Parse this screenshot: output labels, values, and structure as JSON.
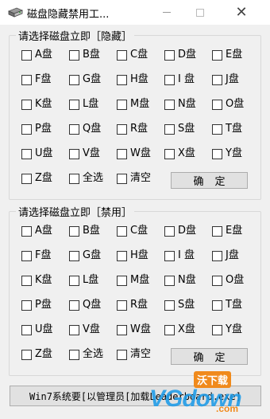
{
  "window": {
    "title": "磁盘隐藏禁用工...",
    "minimize_glyph": "—",
    "maximize_glyph": "☐",
    "close_glyph": "✕"
  },
  "groups": [
    {
      "title": "请选择磁盘立即［隐藏］",
      "drives": [
        "A盘",
        "B盘",
        "C盘",
        "D盘",
        "E盘",
        "F盘",
        "G盘",
        "H盘",
        "I 盘",
        "J盘",
        "K盘",
        "L盘",
        "M盘",
        "N盘",
        "O盘",
        "P盘",
        "Q盘",
        "R盘",
        "S盘",
        "T盘",
        "U盘",
        "V盘",
        "W盘",
        "X盘",
        "Y盘",
        "Z盘",
        "全选",
        "清空"
      ],
      "ok_label": "确定"
    },
    {
      "title": "请选择磁盘立即［禁用］",
      "drives": [
        "A盘",
        "B盘",
        "C盘",
        "D盘",
        "E盘",
        "F盘",
        "G盘",
        "H盘",
        "I 盘",
        "J盘",
        "K盘",
        "L盘",
        "M盘",
        "N盘",
        "O盘",
        "P盘",
        "Q盘",
        "R盘",
        "S盘",
        "T盘",
        "U盘",
        "V盘",
        "W盘",
        "X盘",
        "Y盘",
        "Z盘",
        "全选",
        "清空"
      ],
      "ok_label": "确定"
    }
  ],
  "bottom_button": "Win7系统要[以管理员[加载Leaderboard.exe]",
  "watermark": {
    "main": "VGdown",
    "cn": "沃下载",
    "url": ".com"
  }
}
